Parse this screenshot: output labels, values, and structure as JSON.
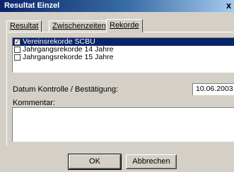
{
  "window": {
    "title": "Resultat Einzel",
    "close_glyph": "x"
  },
  "tabs": [
    {
      "label": "Resultat"
    },
    {
      "label": "Zwischenzeiten"
    },
    {
      "label": "Rekorde"
    }
  ],
  "records_list": [
    {
      "label": "Vereinsrekorde SCBU",
      "checked": true,
      "selected": true
    },
    {
      "label": "Jahrgangsrekorde 14 Jahre",
      "checked": false,
      "selected": false
    },
    {
      "label": "Jahrgangsrekorde 15 Jahre",
      "checked": false,
      "selected": false
    }
  ],
  "date_label": "Datum Kontrolle / Bestätigung:",
  "date_value": "10.06.2003",
  "comment_label": "Kommentar:",
  "comment_value": "",
  "buttons": {
    "ok": "OK",
    "cancel": "Abbrechen"
  },
  "colors": {
    "title_start": "#0a246a",
    "title_end": "#a6caf0",
    "face": "#d4d0c8",
    "selection": "#0a246a"
  }
}
